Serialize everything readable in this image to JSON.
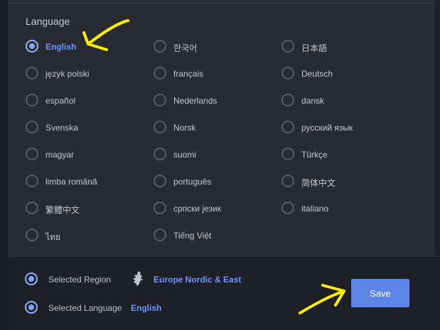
{
  "section": {
    "title": "Language"
  },
  "languages": [
    {
      "label": "English",
      "selected": true
    },
    {
      "label": "한국어",
      "selected": false
    },
    {
      "label": "日本語",
      "selected": false
    },
    {
      "label": "język polski",
      "selected": false
    },
    {
      "label": "français",
      "selected": false
    },
    {
      "label": "Deutsch",
      "selected": false
    },
    {
      "label": "español",
      "selected": false
    },
    {
      "label": "Nederlands",
      "selected": false
    },
    {
      "label": "dansk",
      "selected": false
    },
    {
      "label": "Svenska",
      "selected": false
    },
    {
      "label": "Norsk",
      "selected": false
    },
    {
      "label": "русский язык",
      "selected": false
    },
    {
      "label": "magyar",
      "selected": false
    },
    {
      "label": "suomi",
      "selected": false
    },
    {
      "label": "Türkçe",
      "selected": false
    },
    {
      "label": "limba română",
      "selected": false
    },
    {
      "label": "português",
      "selected": false
    },
    {
      "label": "简体中文",
      "selected": false
    },
    {
      "label": "繁體中文",
      "selected": false
    },
    {
      "label": "српски језик",
      "selected": false
    },
    {
      "label": "italiano",
      "selected": false
    },
    {
      "label": "ไทย",
      "selected": false
    },
    {
      "label": "Tiếng Việt",
      "selected": false
    }
  ],
  "bottom": {
    "region_label": "Selected Region",
    "region_value": "Europe Nordic & East",
    "region_icon": "europe-map-icon",
    "language_label": "Selected Language",
    "language_value": "English",
    "save_label": "Save"
  },
  "colors": {
    "accent": "#6d97ff",
    "button": "#5b84e8",
    "background": "#2a2b30",
    "annotation": "#ffef00"
  }
}
